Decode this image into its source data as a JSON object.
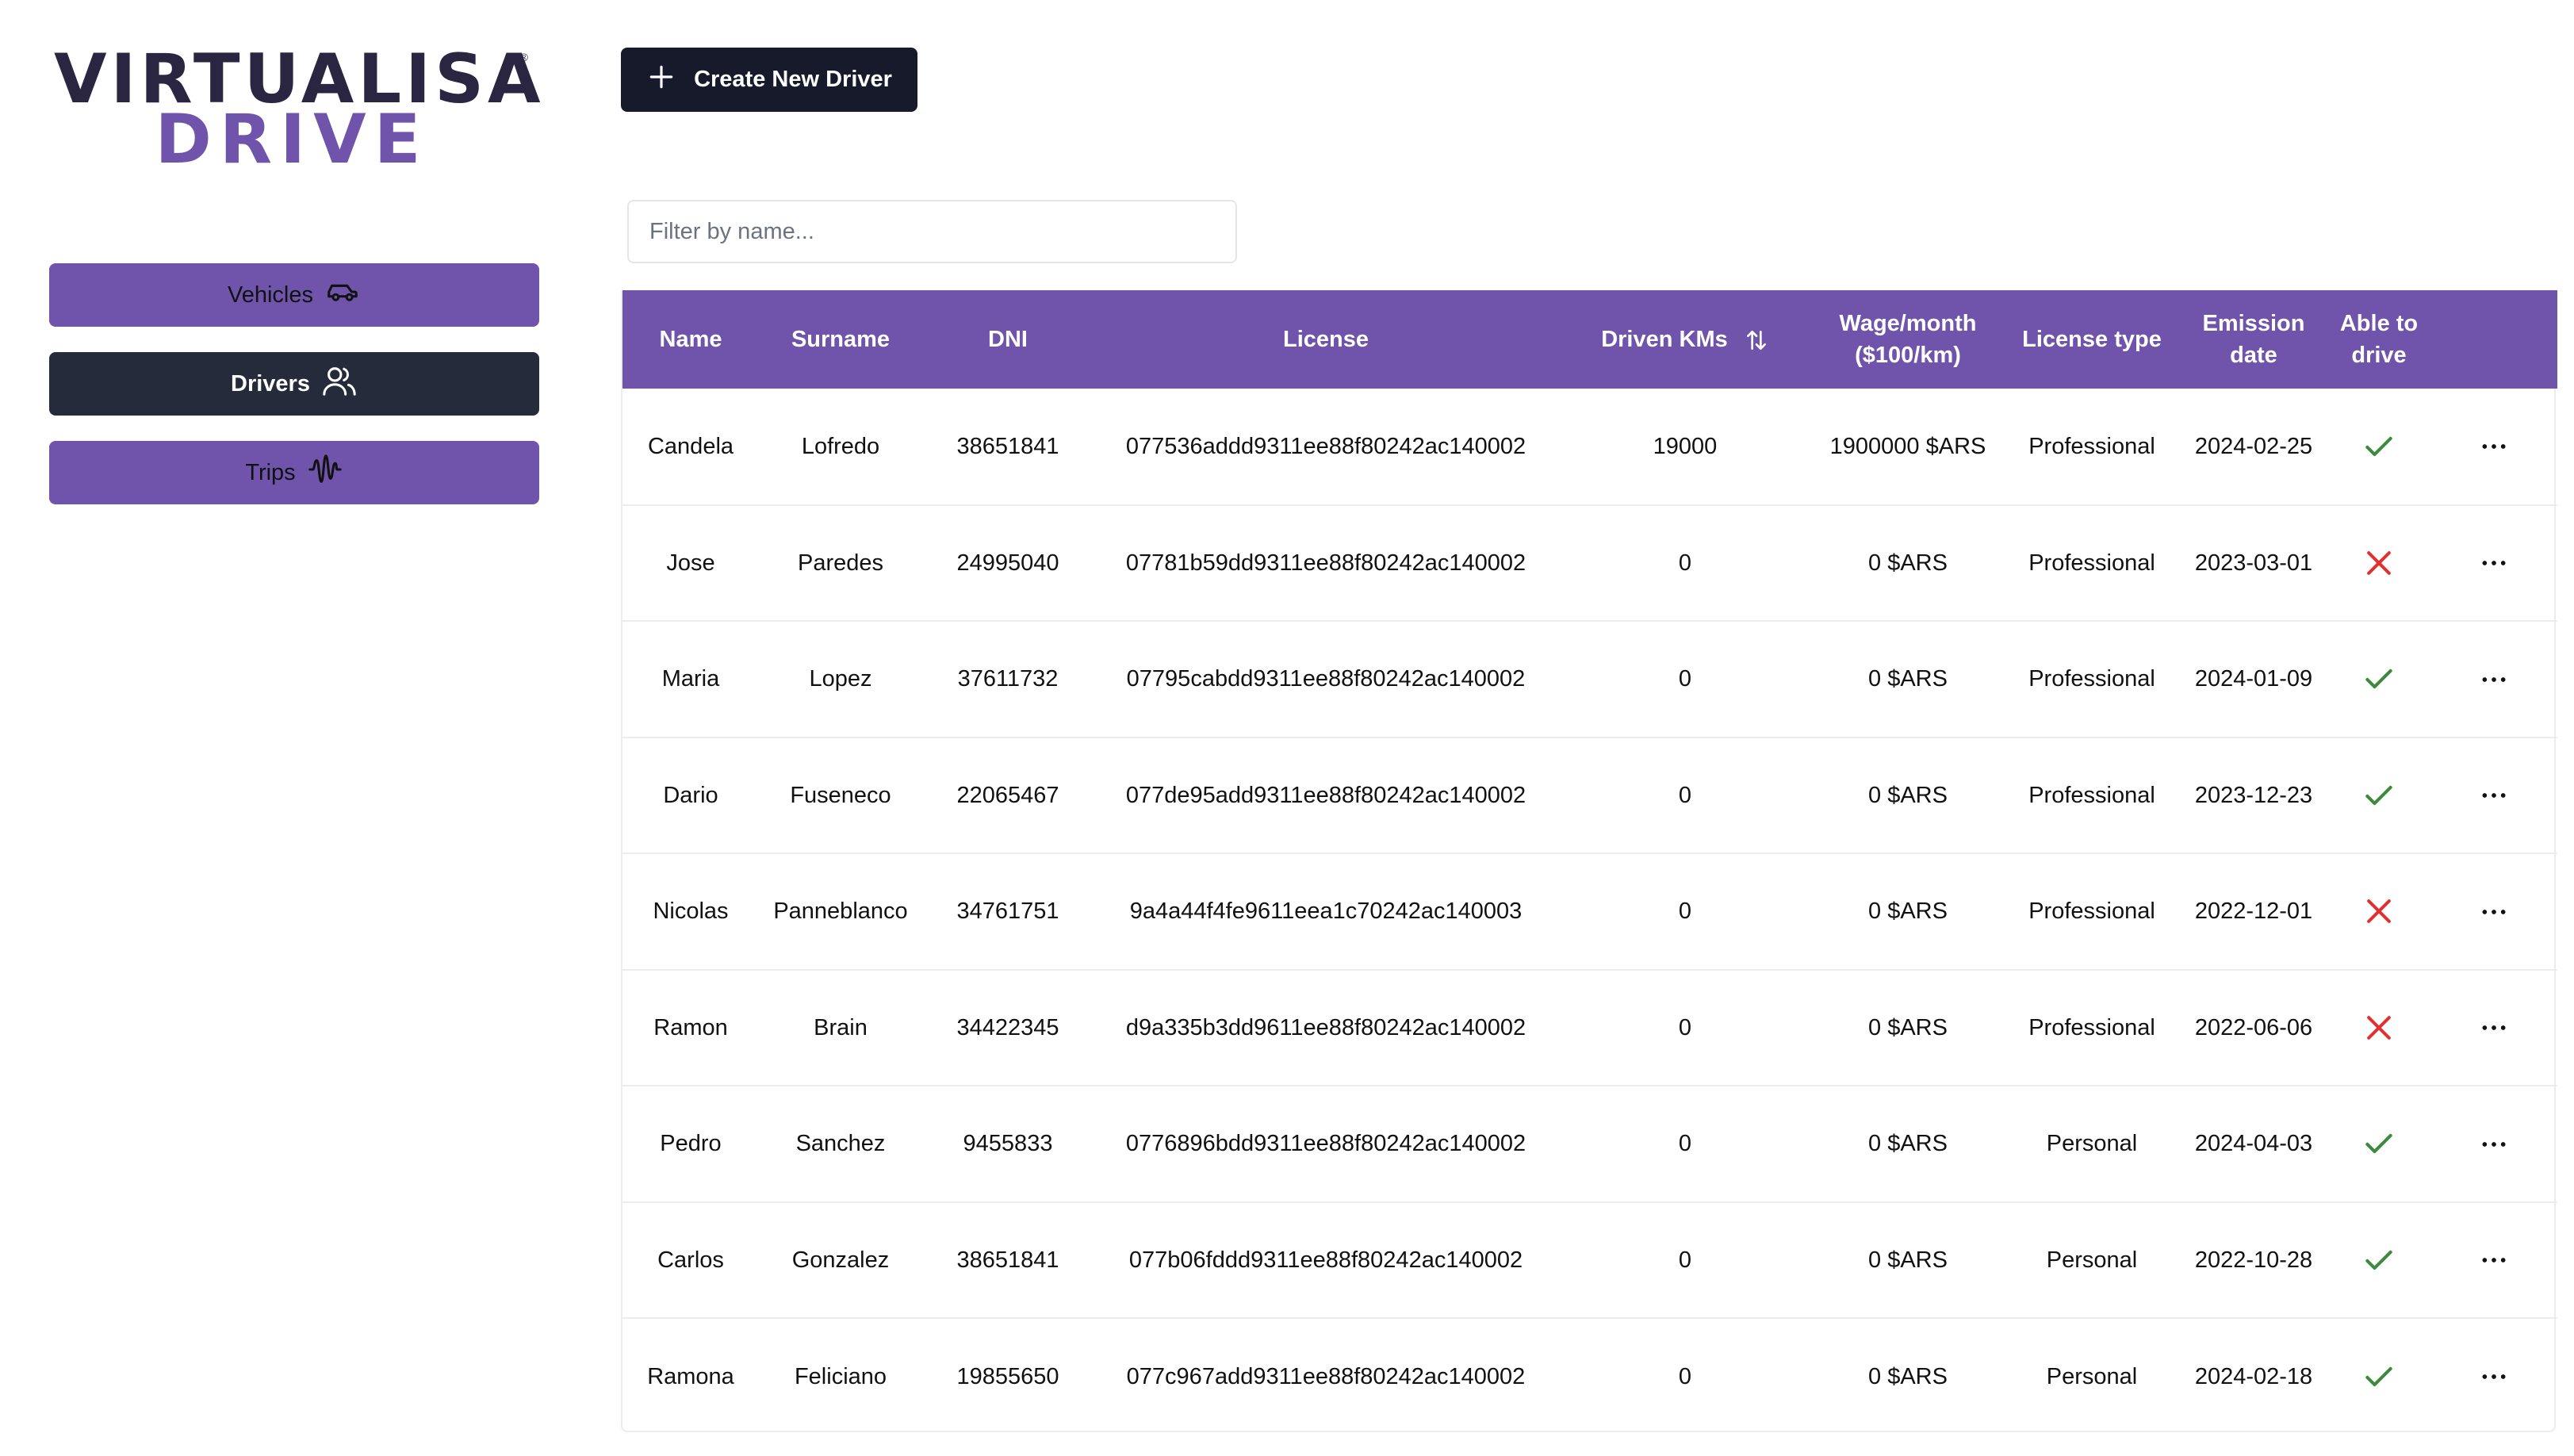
{
  "brand": {
    "line1": "VIRTUALISA",
    "line2": "DRIVE",
    "registered": "®"
  },
  "colors": {
    "accent": "#7054ab",
    "dark": "#161a2b",
    "ok": "#3c8a3c",
    "bad": "#e03131"
  },
  "sidebar": {
    "items": [
      {
        "label": "Vehicles",
        "icon": "car-icon"
      },
      {
        "label": "Drivers",
        "icon": "users-icon",
        "active": true
      },
      {
        "label": "Trips",
        "icon": "waveform-icon"
      }
    ]
  },
  "toolbar": {
    "create_label": "Create New Driver",
    "create_icon": "plus-icon"
  },
  "filter": {
    "placeholder": "Filter by name...",
    "value": ""
  },
  "table": {
    "columns": [
      "Name",
      "Surname",
      "DNI",
      "License",
      "Driven KMs",
      "Wage/month ($100/km)",
      "License type",
      "Emission date",
      "Able to drive",
      ""
    ],
    "sort_icon": "sort-arrows-icon",
    "rows": [
      {
        "name": "Candela",
        "surname": "Lofredo",
        "dni": "38651841",
        "license": "077536addd9311ee88f80242ac140002",
        "kms": "19000",
        "wage": "1900000 $ARS",
        "type": "Professional",
        "date": "2024-02-25",
        "able": true
      },
      {
        "name": "Jose",
        "surname": "Paredes",
        "dni": "24995040",
        "license": "07781b59dd9311ee88f80242ac140002",
        "kms": "0",
        "wage": "0 $ARS",
        "type": "Professional",
        "date": "2023-03-01",
        "able": false
      },
      {
        "name": "Maria",
        "surname": "Lopez",
        "dni": "37611732",
        "license": "07795cabdd9311ee88f80242ac140002",
        "kms": "0",
        "wage": "0 $ARS",
        "type": "Professional",
        "date": "2024-01-09",
        "able": true
      },
      {
        "name": "Dario",
        "surname": "Fuseneco",
        "dni": "22065467",
        "license": "077de95add9311ee88f80242ac140002",
        "kms": "0",
        "wage": "0 $ARS",
        "type": "Professional",
        "date": "2023-12-23",
        "able": true
      },
      {
        "name": "Nicolas",
        "surname": "Panneblanco",
        "dni": "34761751",
        "license": "9a4a44f4fe9611eea1c70242ac140003",
        "kms": "0",
        "wage": "0 $ARS",
        "type": "Professional",
        "date": "2022-12-01",
        "able": false
      },
      {
        "name": "Ramon",
        "surname": "Brain",
        "dni": "34422345",
        "license": "d9a335b3dd9611ee88f80242ac140002",
        "kms": "0",
        "wage": "0 $ARS",
        "type": "Professional",
        "date": "2022-06-06",
        "able": false
      },
      {
        "name": "Pedro",
        "surname": "Sanchez",
        "dni": "9455833",
        "license": "0776896bdd9311ee88f80242ac140002",
        "kms": "0",
        "wage": "0 $ARS",
        "type": "Personal",
        "date": "2024-04-03",
        "able": true
      },
      {
        "name": "Carlos",
        "surname": "Gonzalez",
        "dni": "38651841",
        "license": "077b06fddd9311ee88f80242ac140002",
        "kms": "0",
        "wage": "0 $ARS",
        "type": "Personal",
        "date": "2022-10-28",
        "able": true
      },
      {
        "name": "Ramona",
        "surname": "Feliciano",
        "dni": "19855650",
        "license": "077c967add9311ee88f80242ac140002",
        "kms": "0",
        "wage": "0 $ARS",
        "type": "Personal",
        "date": "2024-02-18",
        "able": true
      }
    ]
  }
}
